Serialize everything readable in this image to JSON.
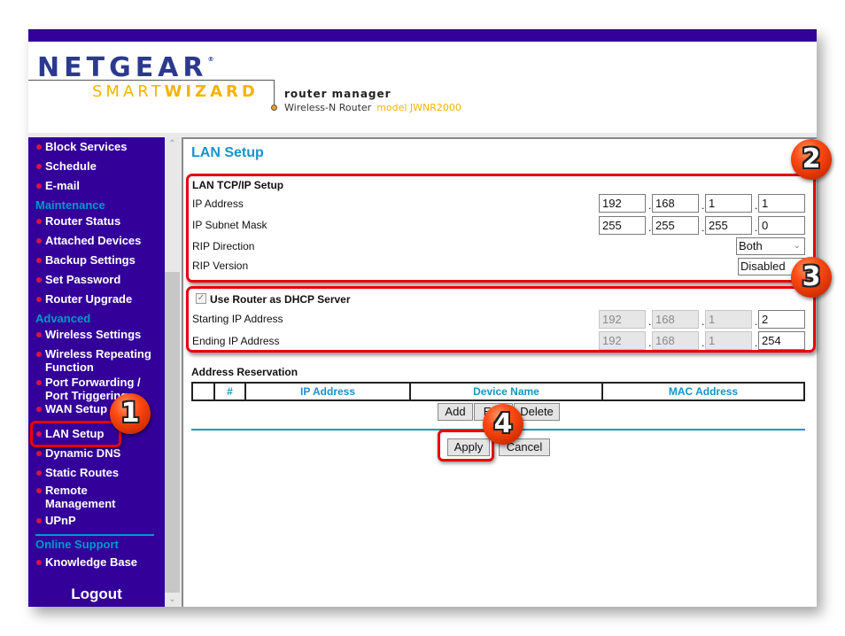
{
  "header": {
    "brand": "NETGEAR",
    "brand_mark": "®",
    "smart": "SMART",
    "wizard": "WIZARD",
    "title": "router manager",
    "product": "Wireless-N Router",
    "model": "model JWNR2000"
  },
  "sidebar": {
    "items": [
      {
        "type": "item",
        "label": "Block Services"
      },
      {
        "type": "item",
        "label": "Schedule"
      },
      {
        "type": "item",
        "label": "E-mail"
      },
      {
        "type": "section",
        "label": "Maintenance"
      },
      {
        "type": "item",
        "label": "Router Status"
      },
      {
        "type": "item",
        "label": "Attached Devices"
      },
      {
        "type": "item",
        "label": "Backup Settings"
      },
      {
        "type": "item",
        "label": "Set Password"
      },
      {
        "type": "item",
        "label": "Router Upgrade"
      },
      {
        "type": "section",
        "label": "Advanced"
      },
      {
        "type": "item",
        "label": "Wireless Settings"
      },
      {
        "type": "item",
        "label": "Wireless Repeating",
        "label2": "Function"
      },
      {
        "type": "item",
        "label": "Port Forwarding /",
        "label2": "Port Triggering"
      },
      {
        "type": "item",
        "label": "WAN Setup"
      },
      {
        "type": "item",
        "label": "LAN Setup"
      },
      {
        "type": "item",
        "label": "Dynamic DNS"
      },
      {
        "type": "item",
        "label": "Static Routes"
      },
      {
        "type": "item",
        "label": "Remote",
        "label2": "Management"
      },
      {
        "type": "item",
        "label": "UPnP"
      },
      {
        "type": "section",
        "label": "Online Support"
      },
      {
        "type": "item",
        "label": "Knowledge Base"
      }
    ],
    "logout": "Logout",
    "scroll_up": "^",
    "scroll_down": "v"
  },
  "main": {
    "title": "LAN Setup",
    "tcpip": {
      "heading": "LAN TCP/IP Setup",
      "ip_label": "IP Address",
      "ip": [
        "192",
        "168",
        "1",
        "1"
      ],
      "mask_label": "IP Subnet Mask",
      "mask": [
        "255",
        "255",
        "255",
        "0"
      ],
      "rip_dir_label": "RIP Direction",
      "rip_dir": "Both",
      "rip_ver_label": "RIP Version",
      "rip_ver": "Disabled"
    },
    "dhcp": {
      "checkbox_label": "Use Router as DHCP Server",
      "checked": true,
      "check_glyph": "✓",
      "start_label": "Starting IP Address",
      "start": [
        "192",
        "168",
        "1",
        "2"
      ],
      "end_label": "Ending IP Address",
      "end": [
        "192",
        "168",
        "1",
        "254"
      ]
    },
    "reservation": {
      "heading": "Address Reservation",
      "columns": [
        "",
        "#",
        "IP Address",
        "Device Name",
        "MAC Address"
      ],
      "buttons": {
        "add": "Add",
        "edit": "Edit",
        "delete": "Delete"
      }
    },
    "actions": {
      "apply": "Apply",
      "cancel": "Cancel"
    },
    "ip_separator": "."
  },
  "annotations": {
    "badges": [
      "1",
      "2",
      "3",
      "4"
    ],
    "highlight_color": "#e6000d"
  },
  "colors": {
    "sidebar_bg": "#330099",
    "accent_blue": "#1793c9",
    "bullet": "#d6134a",
    "logo_yellow": "#f4b400",
    "logo_blue": "#2b3a8f"
  }
}
